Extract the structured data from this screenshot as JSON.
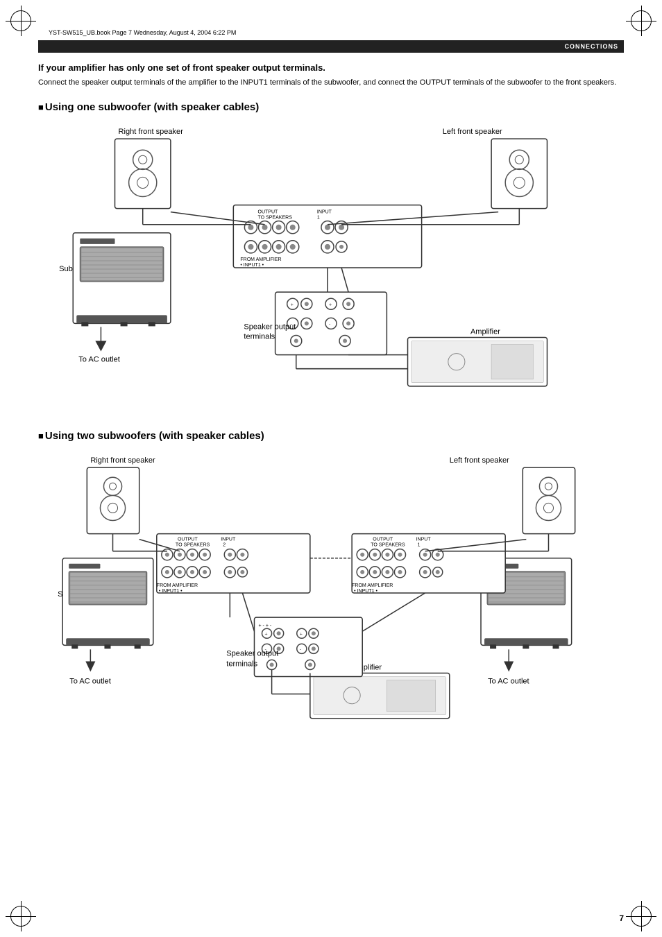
{
  "page": {
    "file_info": "YST-SW515_UB.book  Page 7  Wednesday, August 4, 2004  6:22 PM",
    "header_label": "CONNECTIONS",
    "page_number": "7",
    "section_title": "If your amplifier has only one set of front speaker output terminals.",
    "section_desc": "Connect the speaker output terminals of the amplifier to the INPUT1 terminals of the subwoofer, and connect the OUTPUT terminals of the subwoofer to the front speakers.",
    "diagram1_heading": "Using one subwoofer (with speaker cables)",
    "diagram2_heading": "Using two subwoofers (with speaker cables)",
    "labels": {
      "right_front_speaker": "Right front speaker",
      "left_front_speaker": "Left front speaker",
      "subwoofer": "Subwoofer",
      "amplifier": "Amplifier",
      "to_ac_outlet": "To AC outlet",
      "speaker_output_terminals": "Speaker output\nterminals",
      "speaker_output_terminals2": "Speaker output\nterminals"
    }
  }
}
